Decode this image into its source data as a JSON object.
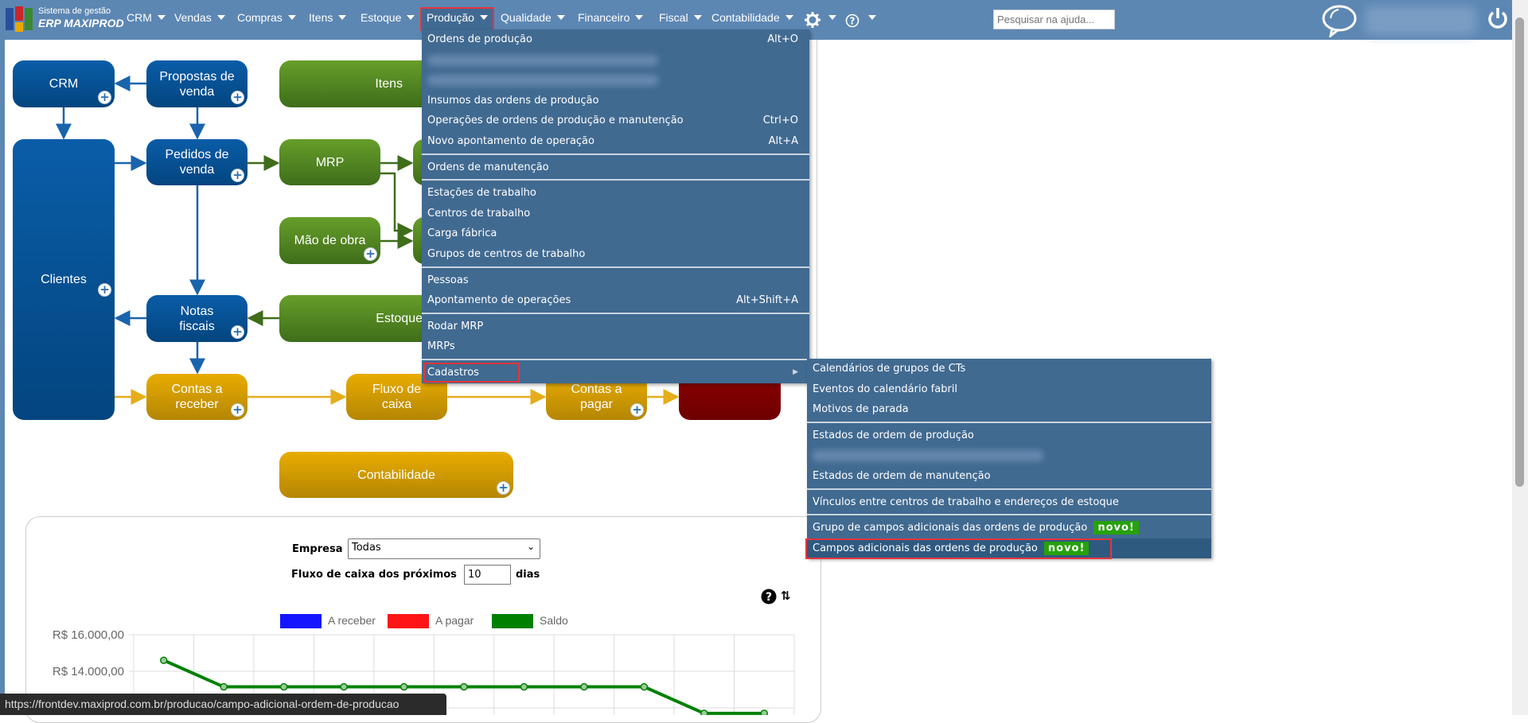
{
  "brand": {
    "line1": "Sistema de gestão",
    "line2": "ERP MAXIPROD"
  },
  "nav": [
    {
      "label": "CRM"
    },
    {
      "label": "Vendas"
    },
    {
      "label": "Compras"
    },
    {
      "label": "Itens"
    },
    {
      "label": "Estoque"
    },
    {
      "label": "Produção",
      "active": true
    },
    {
      "label": "Qualidade"
    },
    {
      "label": "Financeiro"
    },
    {
      "label": "Fiscal"
    },
    {
      "label": "Contabilidade"
    }
  ],
  "icons": {
    "settings": "gear-icon",
    "help": "help-icon",
    "chat": "chat-bubble-icon",
    "power": "power-icon"
  },
  "search": {
    "placeholder": "Pesquisar na ajuda..."
  },
  "menu": {
    "items": [
      {
        "label": "Ordens de produção",
        "shortcut": "Alt+O"
      },
      {
        "blurred": true
      },
      {
        "blurred": true
      },
      {
        "label": "Insumos das ordens de produção"
      },
      {
        "label": "Operações de ordens de produção e manutenção",
        "shortcut": "Ctrl+O"
      },
      {
        "label": "Novo apontamento de operação",
        "shortcut": "Alt+A"
      },
      {
        "sep": true
      },
      {
        "label": "Ordens de manutenção"
      },
      {
        "sep": true
      },
      {
        "label": "Estações de trabalho"
      },
      {
        "label": "Centros de trabalho"
      },
      {
        "label": "Carga fábrica"
      },
      {
        "label": "Grupos de centros de trabalho"
      },
      {
        "sep": true
      },
      {
        "label": "Pessoas"
      },
      {
        "label": "Apontamento de operações",
        "shortcut": "Alt+Shift+A"
      },
      {
        "sep": true
      },
      {
        "label": "Rodar MRP"
      },
      {
        "label": "MRPs"
      },
      {
        "sep": true
      },
      {
        "label": "Cadastros",
        "submenu": true,
        "highlighted": true
      }
    ]
  },
  "submenu": {
    "items": [
      {
        "label": "Calendários de grupos de CTs"
      },
      {
        "label": "Eventos do calendário fabril"
      },
      {
        "label": "Motivos de parada"
      },
      {
        "sep": true
      },
      {
        "label": "Estados de ordem de produção"
      },
      {
        "blurred": true
      },
      {
        "label": "Estados de ordem de manutenção"
      },
      {
        "sep": true
      },
      {
        "label": "Vínculos entre centros de trabalho e endereços de estoque"
      },
      {
        "sep": true
      },
      {
        "label": "Grupo de campos adicionais das ordens de produção",
        "badge": "novo!"
      },
      {
        "label": "Campos adicionais das ordens de produção",
        "badge": "novo!",
        "highlighted": true,
        "hover": true
      }
    ]
  },
  "diagram": {
    "crm": "CRM",
    "propostas": "Propostas de venda",
    "itens": "Itens",
    "clientes": "Clientes",
    "pedidos": "Pedidos de venda",
    "mrp": "MRP",
    "mao": "Mão de obra",
    "notas": "Notas fiscais",
    "estoque": "Estoque",
    "receber": "Contas a receber",
    "fluxo": "Fluxo de caixa",
    "pagar": "Contas a pagar",
    "contabilidade": "Contabilidade",
    "colors": {
      "blue": "#0a5da8",
      "green": "#5a8f26",
      "yellow": "#e0a500",
      "red": "#800000"
    }
  },
  "cashflow": {
    "empresa_label": "Empresa",
    "empresa_value": "Todas",
    "fluxo_label": "Fluxo de caixa dos próximos",
    "dias_value": "10",
    "dias_label": "dias"
  },
  "chart_data": {
    "type": "line",
    "legend": [
      {
        "name": "A receber",
        "color": "#1515ff"
      },
      {
        "name": "A pagar",
        "color": "#ff1515"
      },
      {
        "name": "Saldo",
        "color": "#008000"
      }
    ],
    "legend_position": "top",
    "ytick_labels": [
      "R$ 16.000,00",
      "R$ 14.000,00"
    ],
    "ylim": [
      11000,
      16000
    ],
    "grid": true,
    "series": [
      {
        "name": "Saldo",
        "values": [
          14600,
          13150,
          13150,
          13150,
          13150,
          13150,
          13150,
          13150,
          13150,
          11700,
          11700
        ]
      }
    ]
  },
  "status_url": "https://frontdev.maxiprod.com.br/producao/campo-adicional-ordem-de-producao"
}
